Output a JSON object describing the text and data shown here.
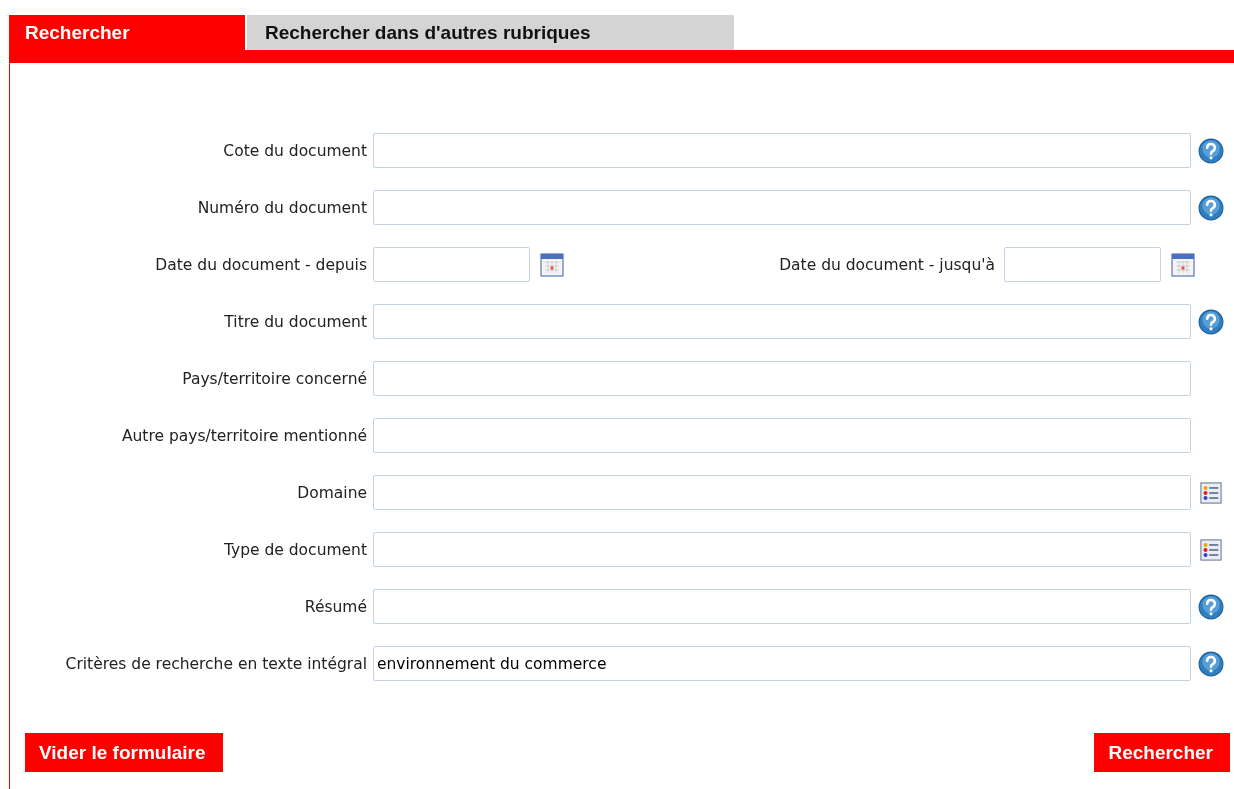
{
  "tabs": [
    {
      "label": "Rechercher",
      "selected": true
    },
    {
      "label": "Rechercher dans d'autres rubriques",
      "selected": false
    }
  ],
  "fields": [
    {
      "kind": "help",
      "label": "Cote du document"
    },
    {
      "kind": "help",
      "label": "Numéro du document"
    },
    {
      "kind": "dates",
      "label": "Date du document - depuis",
      "label_2": "Date du document - jusqu'à"
    },
    {
      "kind": "help",
      "label": "Titre du document"
    },
    {
      "kind": "plain",
      "label": "Pays/territoire concerné"
    },
    {
      "kind": "plain",
      "label": "Autre pays/territoire mentionné"
    },
    {
      "kind": "list",
      "label": "Domaine"
    },
    {
      "kind": "list",
      "label": "Type de document"
    },
    {
      "kind": "help",
      "label": "Résumé"
    },
    {
      "kind": "help",
      "label": "Critères de recherche en texte intégral",
      "value": "environnement du commerce"
    }
  ],
  "buttons": {
    "clear": "Vider le formulaire",
    "search": "Rechercher"
  }
}
